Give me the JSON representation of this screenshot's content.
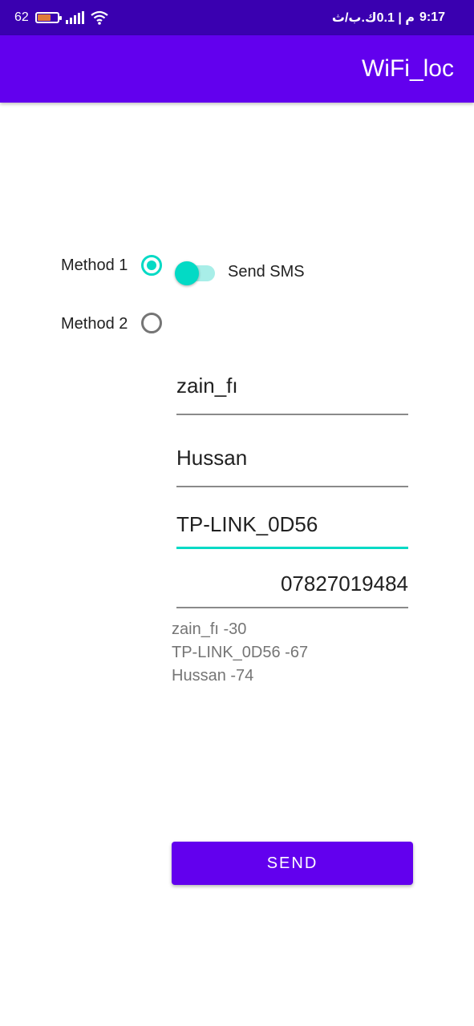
{
  "status_bar": {
    "battery_level": "62",
    "battery_fill_fraction": 0.62,
    "time": "9:17",
    "network_speed": "م | 0.1ك.ب/ث",
    "icons": [
      "battery-icon",
      "signal-bars-icon",
      "wifi-icon"
    ]
  },
  "app_bar": {
    "title": "WiFi_loc"
  },
  "methods": [
    {
      "label": "Method 1",
      "checked": true
    },
    {
      "label": "Method 2",
      "checked": false
    }
  ],
  "sms_switch": {
    "label": "Send SMS",
    "on": true
  },
  "fields": [
    {
      "value": "zain_fı",
      "focused": false
    },
    {
      "value": "Hussan",
      "focused": false
    },
    {
      "value": "TP-LINK_0D56",
      "focused": true
    },
    {
      "value": "07827019484",
      "focused": false
    }
  ],
  "results": [
    "zain_fı -30",
    "TP-LINK_0D56 -67",
    "Hussan -74"
  ],
  "send_button": {
    "label": "SEND"
  },
  "colors": {
    "primary": "#6200ee",
    "status_bar": "#3a00b0",
    "accent": "#03dac5"
  }
}
